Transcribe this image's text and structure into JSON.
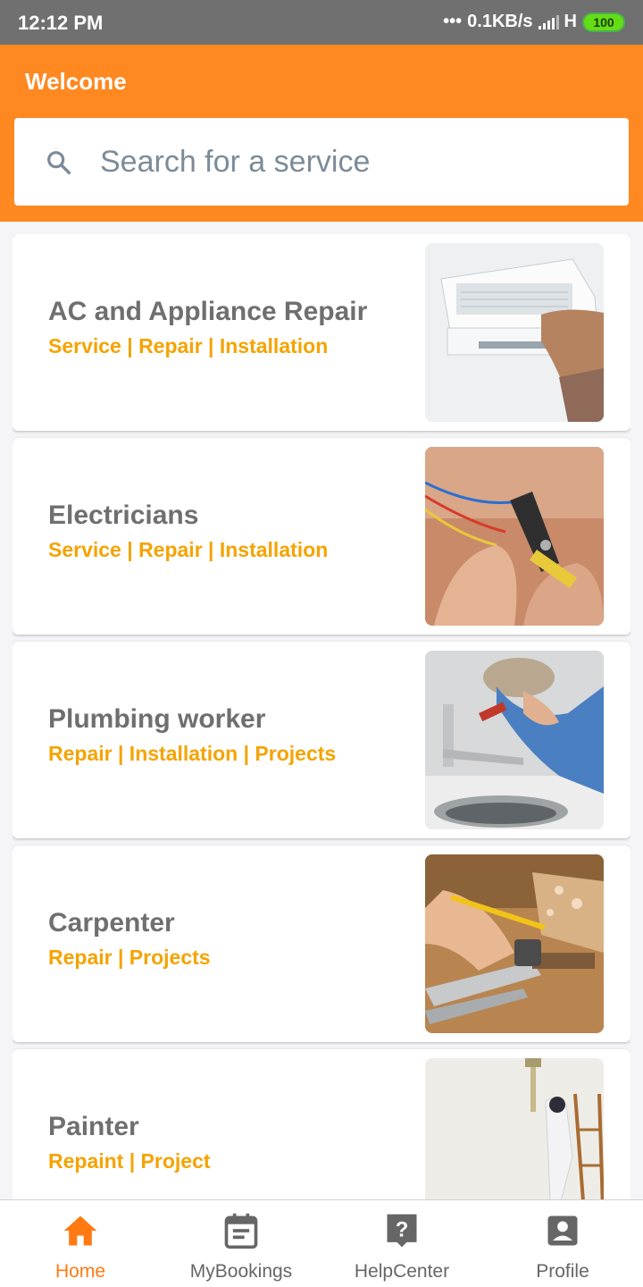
{
  "status_bar": {
    "time": "12:12 PM",
    "network_speed": "0.1KB/s",
    "network_type": "H",
    "battery": "100"
  },
  "header": {
    "title": "Welcome"
  },
  "search": {
    "placeholder": "Search for a service"
  },
  "services": [
    {
      "title": "AC and Appliance Repair",
      "subtitle": "Service | Repair | Installation"
    },
    {
      "title": "Electricians",
      "subtitle": "Service | Repair | Installation"
    },
    {
      "title": "Plumbing worker",
      "subtitle": "Repair | Installation | Projects"
    },
    {
      "title": "Carpenter",
      "subtitle": "Repair | Projects"
    },
    {
      "title": "Painter",
      "subtitle": "Repaint | Project"
    }
  ],
  "bottom_nav": [
    {
      "label": "Home",
      "icon": "home-icon",
      "active": true
    },
    {
      "label": "MyBookings",
      "icon": "calendar-icon",
      "active": false
    },
    {
      "label": "HelpCenter",
      "icon": "help-icon",
      "active": false
    },
    {
      "label": "Profile",
      "icon": "profile-icon",
      "active": false
    }
  ],
  "colors": {
    "accent": "#ff8820",
    "subtitle": "#f5a300",
    "status_bar": "#707070",
    "active_nav": "#ff7a12",
    "inactive_nav": "#666666"
  }
}
